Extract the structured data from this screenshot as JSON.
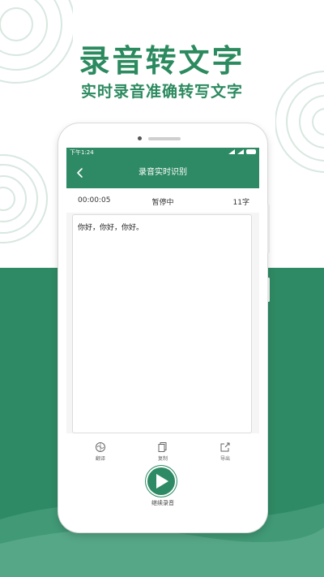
{
  "promo": {
    "headline": "录音转文字",
    "subheadline": "实时录音准确转写文字"
  },
  "status_bar": {
    "time": "下午1:24"
  },
  "header": {
    "title": "录音实时识别",
    "back_icon": "chevron-left-icon"
  },
  "recording_info": {
    "elapsed": "00:00:05",
    "state": "暂停中",
    "char_count": "11字"
  },
  "transcript": {
    "text": "你好，你好，你好。"
  },
  "toolbar": {
    "translate_label": "翻译",
    "copy_label": "复制",
    "export_label": "导出",
    "continue_label": "继续录音"
  },
  "colors": {
    "accent": "#2e8a64",
    "headline": "#2c8a5f",
    "background_green": "#2e8a64"
  }
}
